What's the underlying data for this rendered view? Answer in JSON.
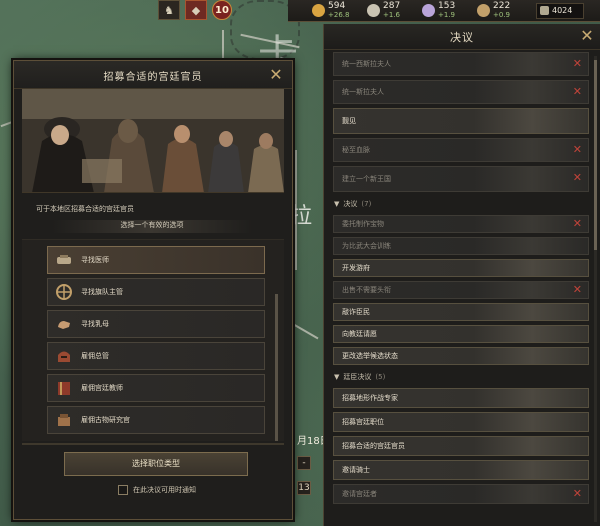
{
  "map": {
    "date_fragment": "月18日",
    "speed_buttons": [
      "-",
      "13"
    ]
  },
  "top_bar": {
    "alerts": [
      {
        "icon": "horse-icon"
      },
      {
        "icon": "warning-diamond-icon"
      },
      {
        "icon": "character-badge-icon",
        "value": "10"
      }
    ],
    "resources": [
      {
        "icon": "gold-icon",
        "value": "594",
        "delta": "+26.8",
        "color": "#d9a441"
      },
      {
        "icon": "prestige-icon",
        "value": "287",
        "delta": "+1.6",
        "color": "#c9c3b2"
      },
      {
        "icon": "piety-icon",
        "value": "153",
        "delta": "+1.9",
        "color": "#b9a4d9"
      },
      {
        "icon": "renown-icon",
        "value": "222",
        "delta": "+0.9",
        "color": "#c2a06a"
      }
    ],
    "soldiers": {
      "icon": "soldiers-icon",
      "value": "4024"
    }
  },
  "decisions": {
    "title": "决议",
    "rows_top": [
      {
        "label": "统一西斯拉夫人",
        "available": false
      },
      {
        "label": "统一斯拉夫人",
        "available": false
      },
      {
        "label": "觐见",
        "available": true
      },
      {
        "label": "秘至血脉",
        "available": false
      },
      {
        "label": "建立一个新王国",
        "available": false
      }
    ],
    "category_1": {
      "label": "决议",
      "count": "(7)"
    },
    "rows_mid": [
      {
        "label": "委托制作宝物",
        "available": false
      },
      {
        "label": "为比武大会训练",
        "available": false
      },
      {
        "label": "开发游府",
        "available": true
      },
      {
        "label": "出售不需要头衔",
        "available": false
      },
      {
        "label": "敲诈臣民",
        "available": true
      },
      {
        "label": "向教廷请愿",
        "available": true
      },
      {
        "label": "更改选举候选状态",
        "available": true
      }
    ],
    "category_2": {
      "label": "廷臣决议",
      "count": "(5)"
    },
    "rows_bottom": [
      {
        "label": "招募地形作战专家",
        "available": true
      },
      {
        "label": "招募宫廷职位",
        "available": true
      },
      {
        "label": "招募合适的宫廷官员",
        "available": true
      },
      {
        "label": "邀请骑士",
        "available": true
      },
      {
        "label": "邀请宫廷者",
        "available": false
      }
    ]
  },
  "modal": {
    "title": "招募合适的宫廷官员",
    "description": "可于本地区招募合适的宫廷官员",
    "subtitle": "选择一个有效的选项",
    "options": [
      {
        "label": "寻找医师",
        "icon": "medicine-icon",
        "selected": true
      },
      {
        "label": "寻找旗队主管",
        "icon": "wheel-icon",
        "selected": false
      },
      {
        "label": "寻找乳母",
        "icon": "hand-icon",
        "selected": false
      },
      {
        "label": "雇佣总管",
        "icon": "helmet-icon",
        "selected": false
      },
      {
        "label": "雇佣宫廷教师",
        "icon": "book-icon",
        "selected": false
      },
      {
        "label": "雇佣古物研究官",
        "icon": "artifact-icon",
        "selected": false
      }
    ],
    "confirm_label": "选择职位类型",
    "notify_label": "在此决议可用时通知"
  }
}
